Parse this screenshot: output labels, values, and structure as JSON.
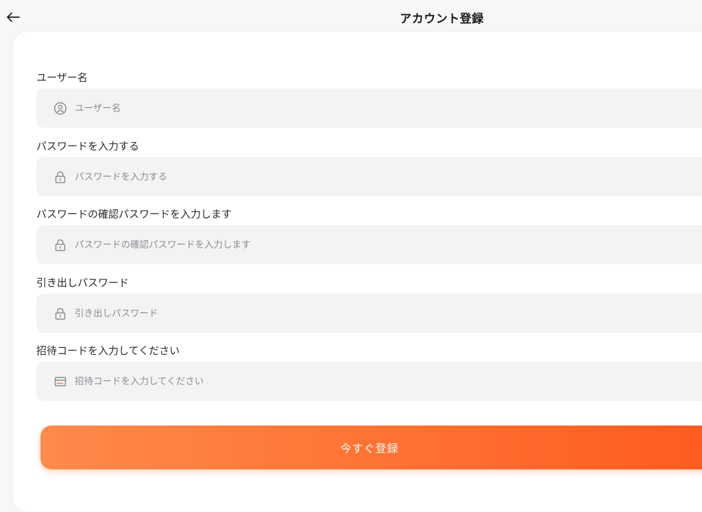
{
  "header": {
    "title": "アカウント登録",
    "back_icon": "arrow-left-icon"
  },
  "form": {
    "username": {
      "label": "ユーザー名",
      "placeholder": "ユーザー名",
      "icon": "user-circle-icon"
    },
    "password": {
      "label": "パスワードを入力する",
      "placeholder": "パスワードを入力する",
      "icon": "lock-icon"
    },
    "password_confirm": {
      "label": "パスワードの確認パスワードを入力します",
      "placeholder": "パスワードの確認パスワードを入力します",
      "icon": "lock-icon"
    },
    "withdraw_password": {
      "label": "引き出しパスワード",
      "placeholder": "引き出しパスワード",
      "icon": "lock-icon"
    },
    "invite_code": {
      "label": "招待コードを入力してください",
      "placeholder": "招待コードを入力してください",
      "icon": "card-icon"
    },
    "submit_label": "今すぐ登録"
  },
  "colors": {
    "accent": "#ff7131",
    "accent_light": "#ff8a4a",
    "accent_dark": "#ff5a1f",
    "input_bg": "#f3f3f4",
    "page_bg": "#f7f7f8",
    "placeholder": "#8c8c94",
    "icon": "#8c8c94"
  }
}
